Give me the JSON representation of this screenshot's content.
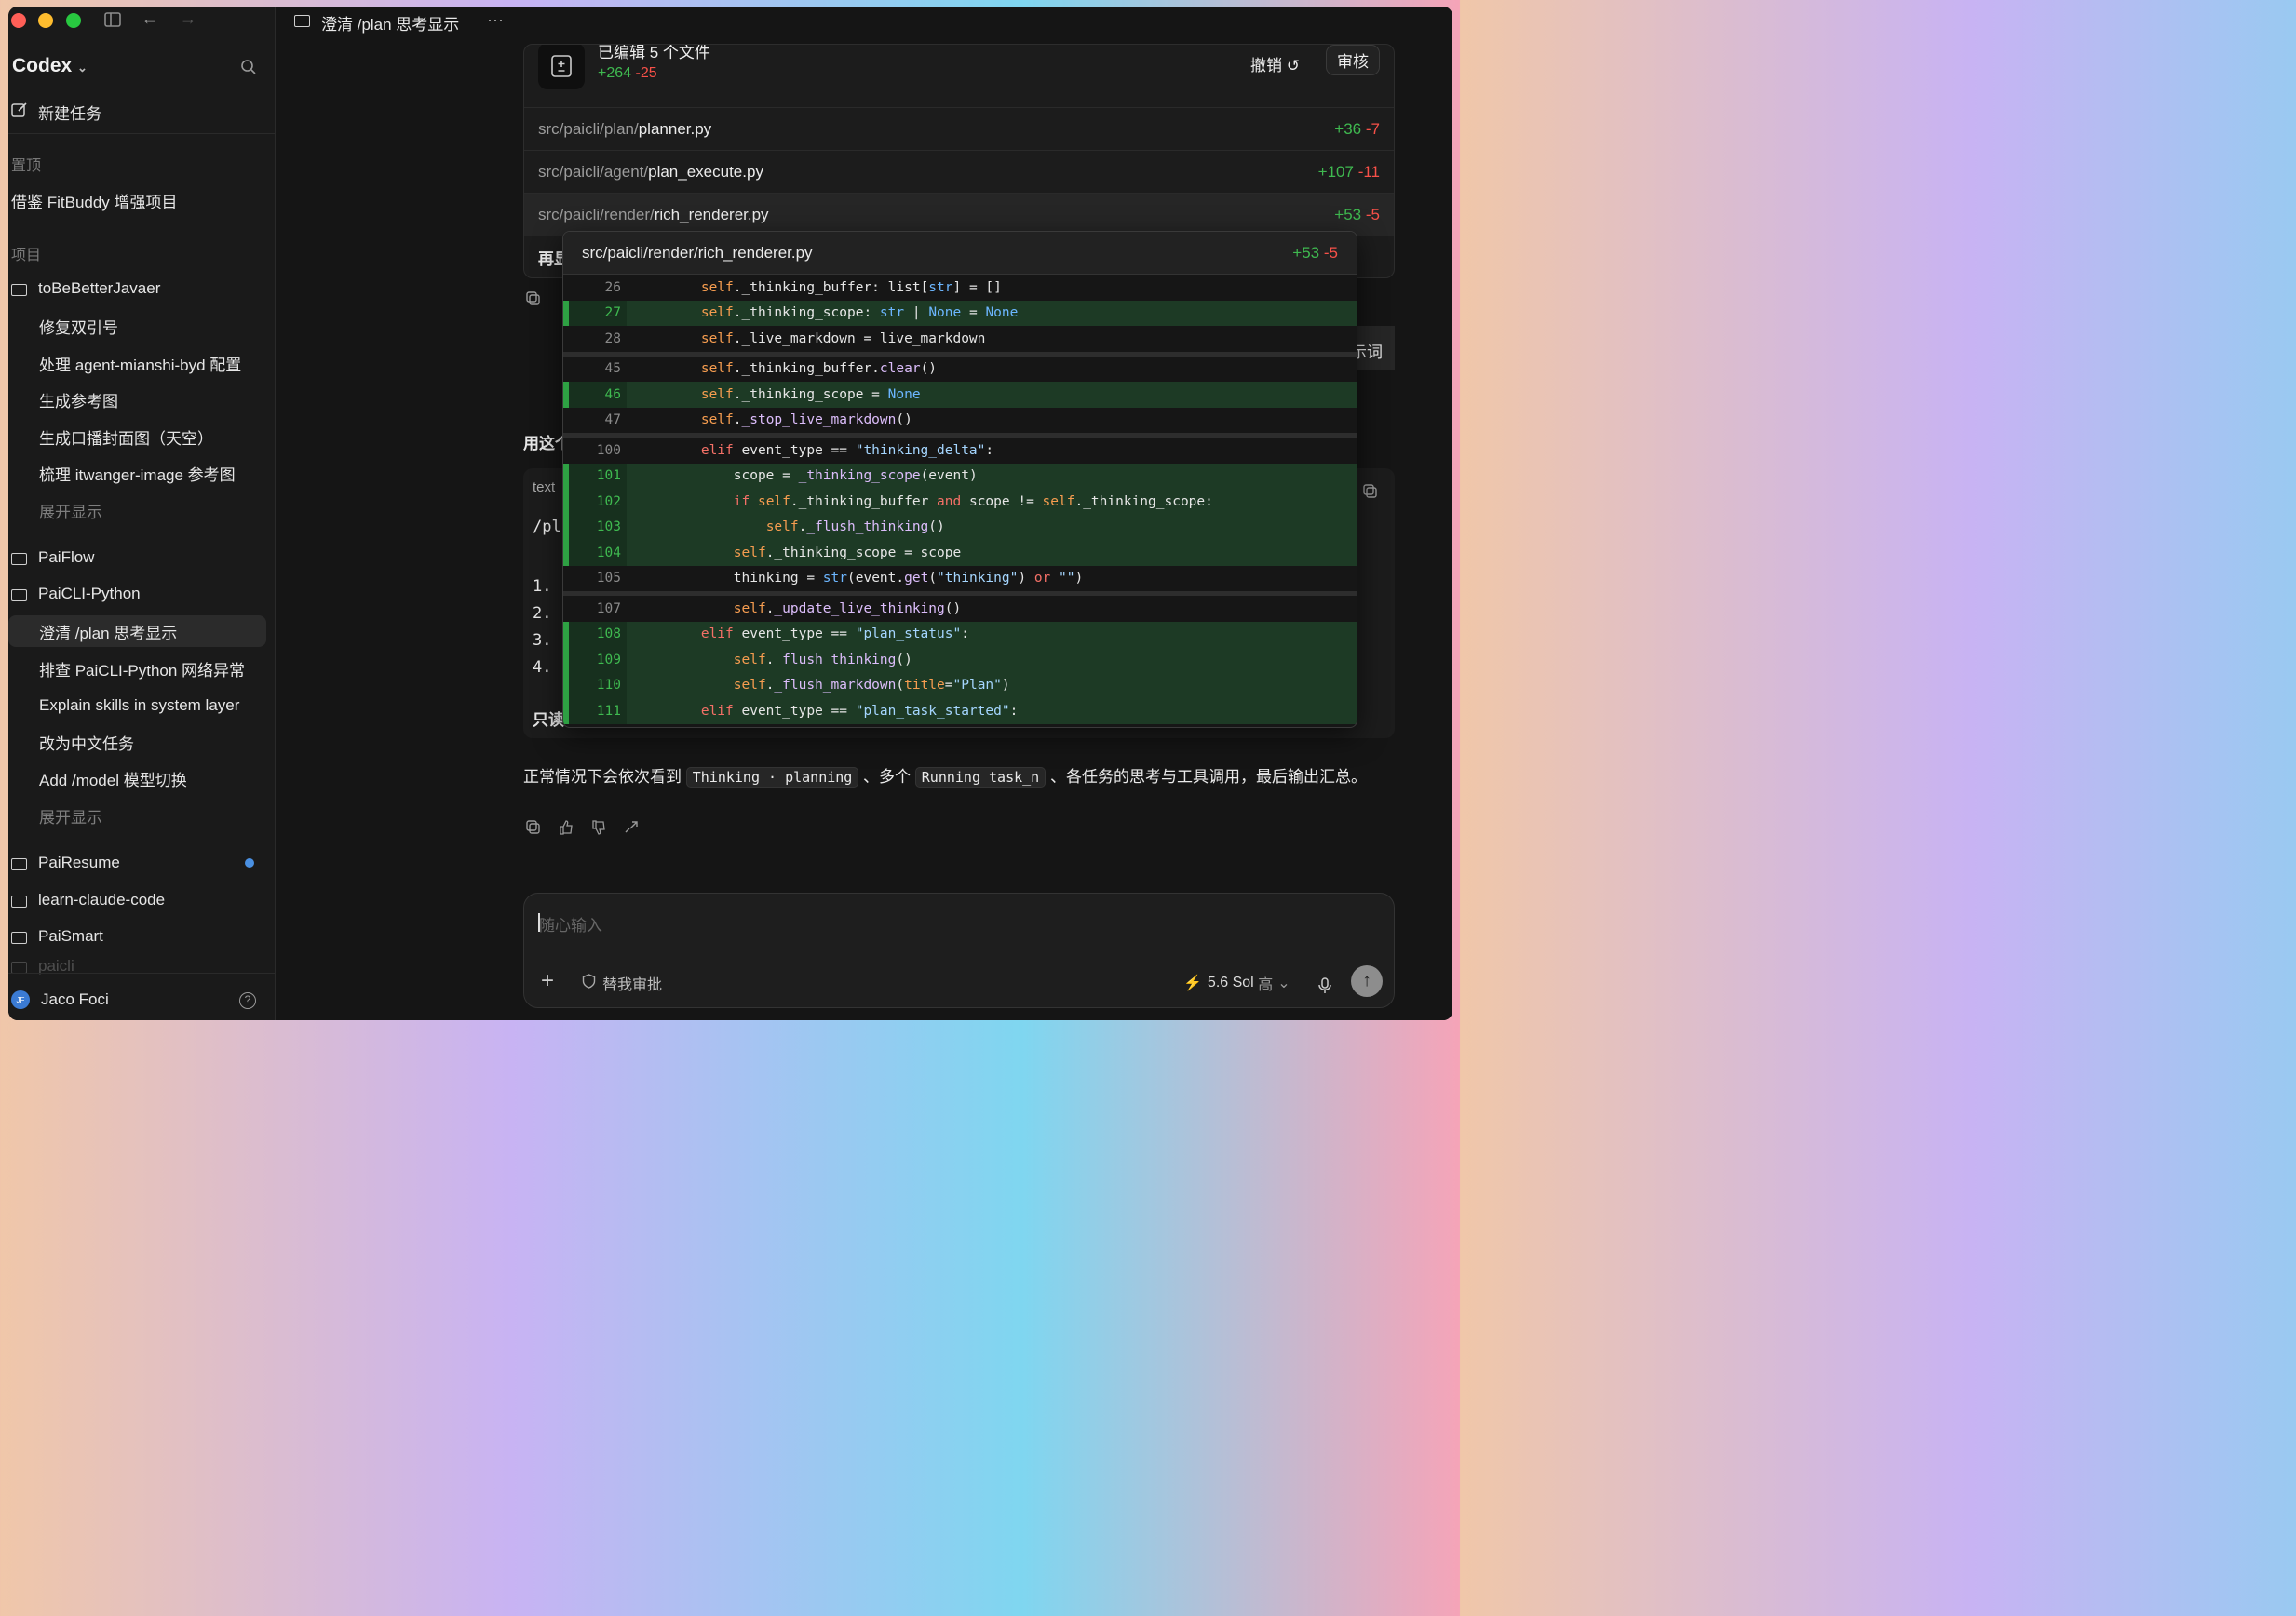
{
  "sidebar": {
    "brand": "Codex",
    "new_task": "新建任务",
    "pinned_label": "置顶",
    "pinned_item": "借鉴 FitBuddy 增强项目",
    "projects_label": "项目",
    "project1": {
      "name": "toBeBetterJavaer",
      "tasks": [
        "修复双引号",
        "处理 agent-mianshi-byd 配置",
        "生成参考图",
        "生成口播封面图（天空）",
        "梳理 itwanger-image 参考图"
      ],
      "expand": "展开显示"
    },
    "project2": {
      "name": "PaiFlow"
    },
    "project3": {
      "name": "PaiCLI-Python",
      "tasks": [
        "澄清 /plan 思考显示",
        "排查 PaiCLI-Python 网络异常",
        "Explain skills in system layer",
        "改为中文任务",
        "Add /model 模型切换"
      ],
      "expand": "展开显示"
    },
    "project4": {
      "name": "PaiResume"
    },
    "project5": {
      "name": "learn-claude-code"
    },
    "project6": {
      "name": "PaiSmart"
    },
    "project7_partial": "paicli",
    "user": {
      "name": "Jaco Foci",
      "initials": "JF"
    }
  },
  "topbar": {
    "title": "澄清 /plan 思考显示",
    "more": "···"
  },
  "edits": {
    "title": "已编辑 5 个文件",
    "added": "+264",
    "removed": "-25",
    "undo_label": "撤销",
    "review_label": "审核",
    "files": [
      {
        "dir": "src/paicli/plan/",
        "name": "planner.py",
        "added": "+36",
        "removed": "-7"
      },
      {
        "dir": "src/paicli/agent/",
        "name": "plan_execute.py",
        "added": "+107",
        "removed": "-11"
      },
      {
        "dir": "src/paicli/render/",
        "name": "rich_renderer.py",
        "added": "+53",
        "removed": "-5"
      }
    ],
    "peek_text": "再显"
  },
  "popup": {
    "path": "src/paicli/render/rich_renderer.py",
    "added": "+53",
    "removed": "-5"
  },
  "behind": {
    "use_this": "用这个",
    "code_lang": "text",
    "code_first": "/pl",
    "list_nums": [
      "1.",
      "2.",
      "3.",
      "4."
    ],
    "readonly": "只读",
    "right_chip": "示词"
  },
  "message": {
    "before": "正常情况下会依次看到 ",
    "chip1": "Thinking · planning",
    "mid": " 、多个 ",
    "chip2": "Running task_n",
    "after": " 、各任务的思考与工具调用，最后输出汇总。"
  },
  "composer": {
    "placeholder": "随心输入",
    "approve": "替我审批",
    "model": "5.6 Sol",
    "effort": "高"
  },
  "colors": {
    "added": "#3fb950",
    "removed": "#f85149",
    "accent_dot": "#4a90e2"
  }
}
